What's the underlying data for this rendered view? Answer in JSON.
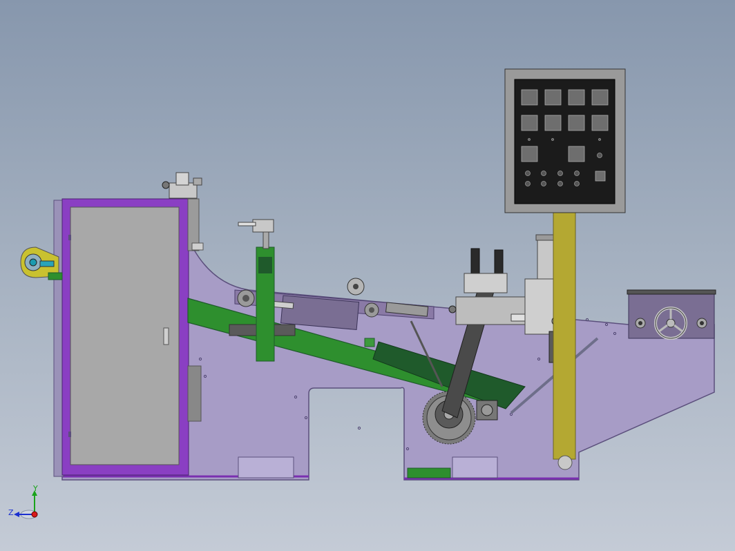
{
  "viewport": {
    "background_top": "#8797ad",
    "background_bottom": "#c4cbd6"
  },
  "colors": {
    "frame_purple": "#a79cc6",
    "frame_edge": "#5b4f7c",
    "door_border": "#8a3fc3",
    "door_panel": "#a8a8a8",
    "conveyor_green": "#2e8f2e",
    "dark_green": "#1f5a2b",
    "olive_post": "#b4a832",
    "panel_black": "#1b1b1b",
    "panel_gray": "#9a9a9a",
    "button_gray": "#6e6e6e",
    "yellow_pulley": "#c9c12f"
  },
  "control_panel": {
    "buttons": 10,
    "indicators": 12
  },
  "orientation_triad": {
    "y_label": "Y",
    "z_label": "Z"
  }
}
